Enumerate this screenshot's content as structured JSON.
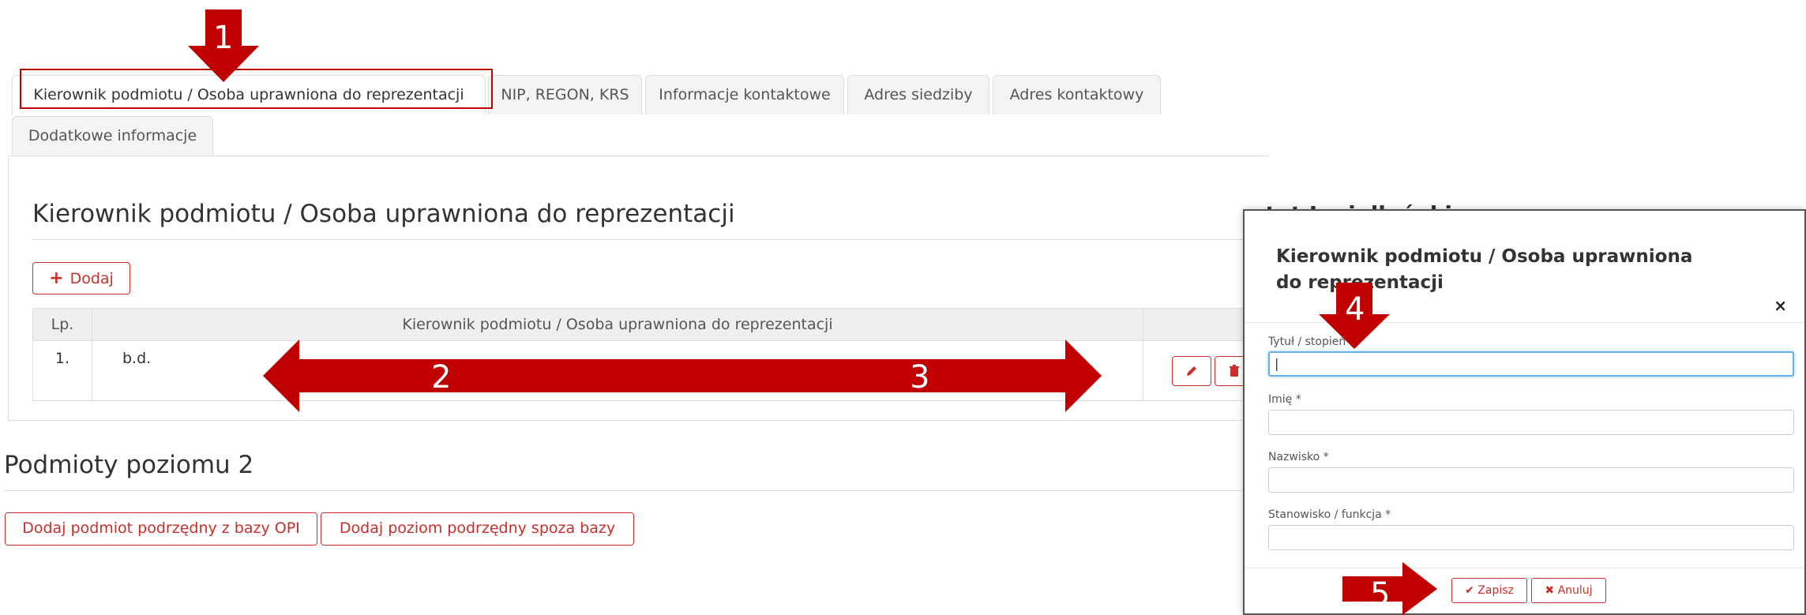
{
  "tabs": {
    "items": [
      {
        "label": "Kierownik podmiotu / Osoba uprawniona do reprezentacji"
      },
      {
        "label": "NIP, REGON, KRS"
      },
      {
        "label": "Informacje kontaktowe"
      },
      {
        "label": "Adres siedziby"
      },
      {
        "label": "Adres kontaktowy"
      },
      {
        "label": "Dodatkowe informacje"
      }
    ],
    "active_index": 0
  },
  "section1": {
    "title": "Kierownik podmiotu / Osoba uprawniona do reprezentacji",
    "add_button": "Dodaj",
    "table": {
      "headers": [
        "Lp.",
        "Kierownik podmiotu / Osoba uprawniona do reprezentacji",
        ""
      ],
      "rows": [
        {
          "lp": "1.",
          "name": "b.d."
        }
      ]
    }
  },
  "section2": {
    "title": "Podmioty poziomu 2",
    "btn_from_db": "Dodaj podmiot podrzędny z bazy OPI",
    "btn_outside_db": "Dodaj poziom podrzędny spoza bazy"
  },
  "modal": {
    "background_peek_text": "ytet Jagielloński",
    "title": "Kierownik podmiotu / Osoba uprawniona do reprezentacji",
    "close": "×",
    "fields": [
      {
        "label": "Tytuł / stopień",
        "value": "|"
      },
      {
        "label": "Imię *",
        "value": ""
      },
      {
        "label": "Nazwisko *",
        "value": ""
      },
      {
        "label": "Stanowisko / funkcja *",
        "value": ""
      }
    ],
    "save": "Zapisz",
    "cancel": "Anuluj"
  },
  "annotations": [
    "1",
    "2",
    "3",
    "4",
    "5"
  ],
  "colors": {
    "accent": "#c9302c",
    "annotation": "#c00000",
    "focus": "#66afe9"
  }
}
